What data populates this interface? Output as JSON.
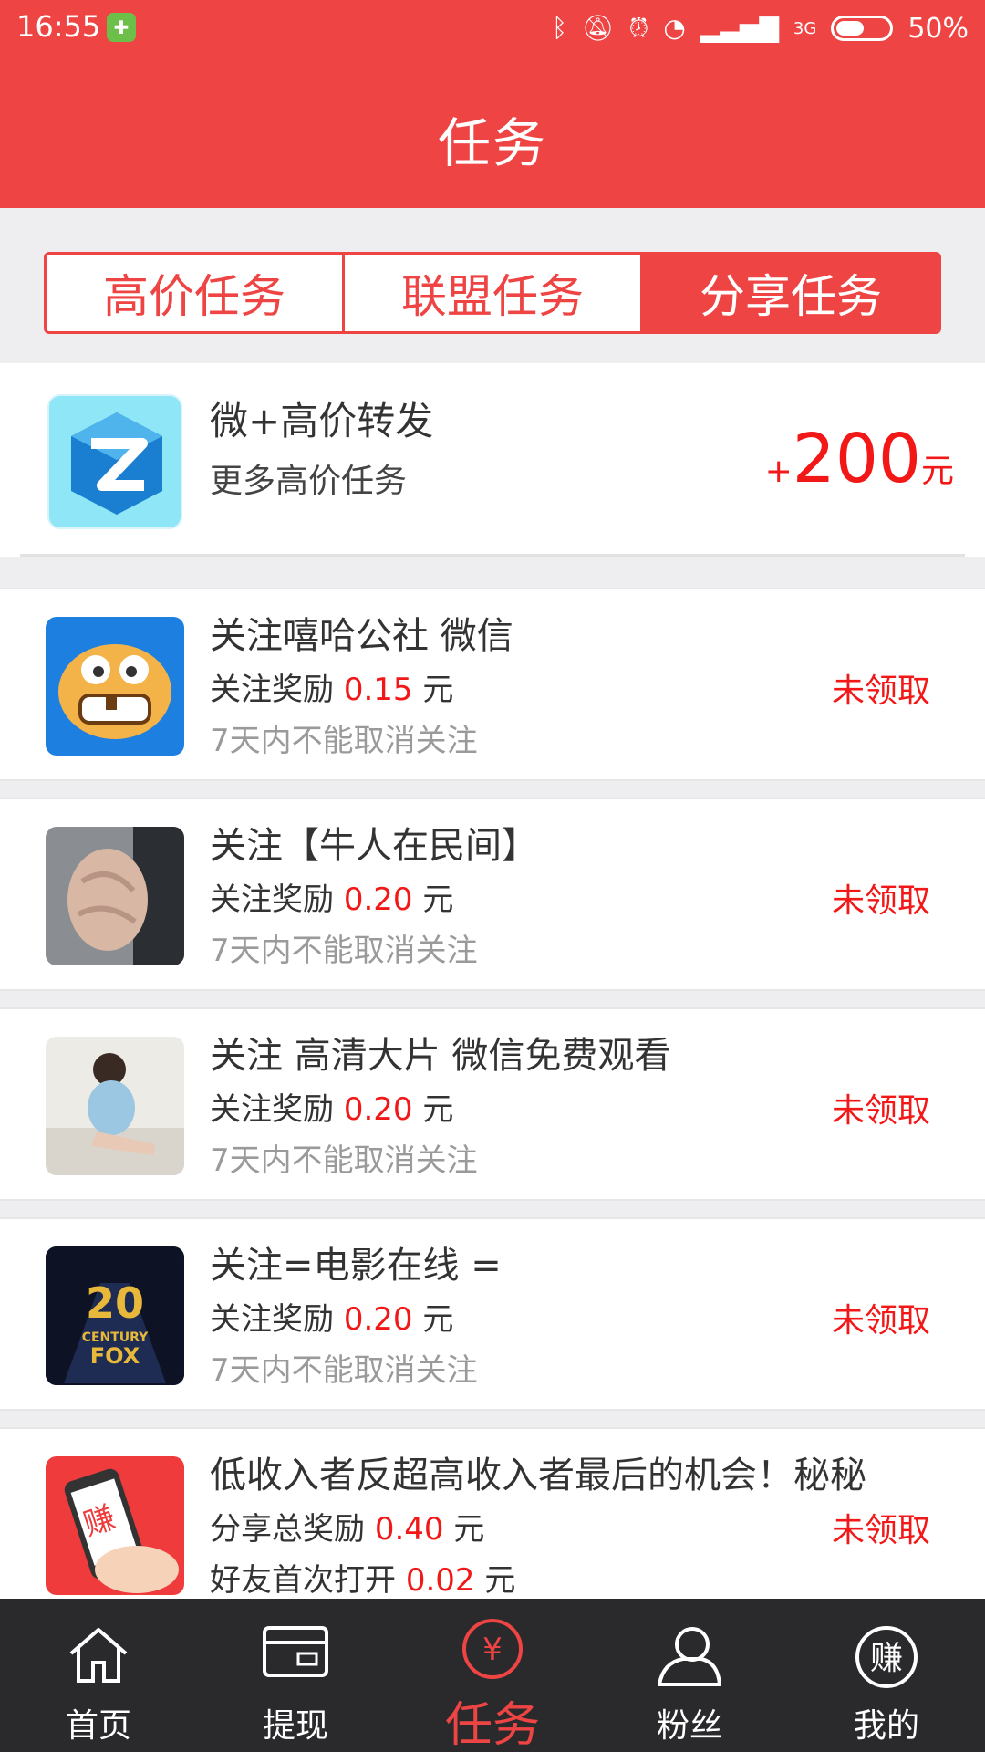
{
  "status_bar": {
    "time": "16:55",
    "network": "3G",
    "battery": "50%"
  },
  "header": {
    "title": "任务"
  },
  "tabs": [
    {
      "label": "高价任务",
      "active": false
    },
    {
      "label": "联盟任务",
      "active": false
    },
    {
      "label": "分享任务",
      "active": true
    }
  ],
  "featured": {
    "title": "微+高价转发",
    "subtitle": "更多高价任务",
    "reward_prefix": "+",
    "reward_value": "200",
    "reward_unit": "元"
  },
  "tasks": [
    {
      "title": "关注嘻哈公社 微信",
      "reward_label": "关注奖励",
      "reward_value": "0.15",
      "reward_unit": "元",
      "note": "7天内不能取消关注",
      "status": "未领取"
    },
    {
      "title": "关注【牛人在民间】",
      "reward_label": "关注奖励",
      "reward_value": "0.20",
      "reward_unit": "元",
      "note": "7天内不能取消关注",
      "status": "未领取"
    },
    {
      "title": "关注 高清大片 微信免费观看",
      "reward_label": "关注奖励",
      "reward_value": "0.20",
      "reward_unit": "元",
      "note": "7天内不能取消关注",
      "status": "未领取"
    },
    {
      "title": "关注=电影在线 =",
      "reward_label": "关注奖励",
      "reward_value": "0.20",
      "reward_unit": "元",
      "note": "7天内不能取消关注",
      "status": "未领取",
      "icon_text": "20th CENTURY FOX"
    },
    {
      "title": "低收入者反超高收入者最后的机会！秘秘",
      "reward_label": "分享总奖励",
      "reward_value": "0.40",
      "reward_unit": "元",
      "extra_label": "好友首次打开",
      "extra_value": "0.02",
      "extra_unit": "元",
      "status": "未领取",
      "icon_text": "赚"
    }
  ],
  "bottom_nav": [
    {
      "label": "首页",
      "icon": "home-icon",
      "active": false
    },
    {
      "label": "提现",
      "icon": "wallet-icon",
      "active": false
    },
    {
      "label": "任务",
      "icon": "yuan-icon",
      "active": true,
      "icon_text": "¥"
    },
    {
      "label": "粉丝",
      "icon": "user-icon",
      "active": false
    },
    {
      "label": "我的",
      "icon": "earn-icon",
      "active": false,
      "icon_text": "赚"
    }
  ],
  "colors": {
    "primary": "#ef4444",
    "reward": "#f21818",
    "nav_bg": "#2a2a2c"
  }
}
